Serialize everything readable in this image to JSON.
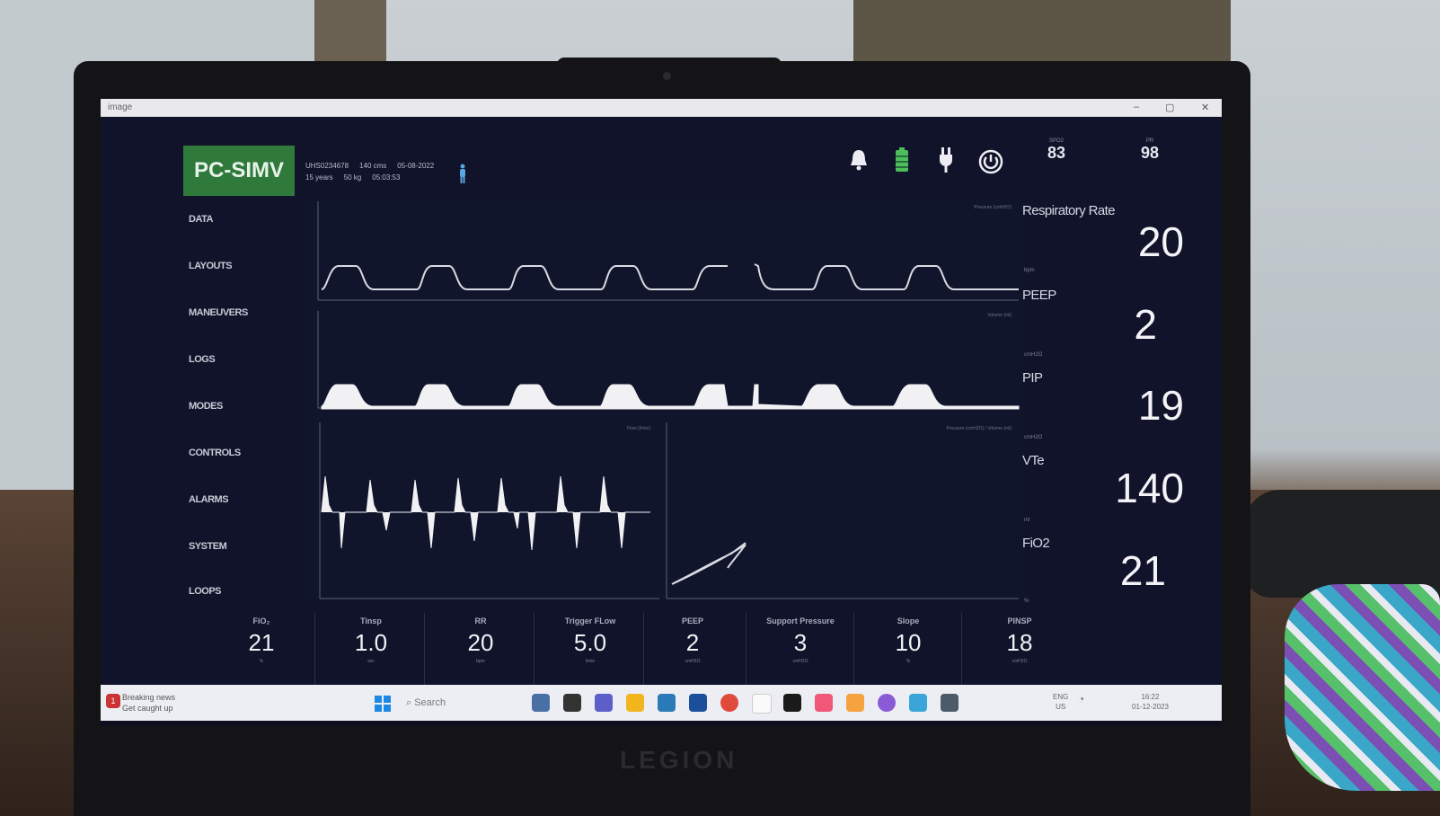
{
  "window": {
    "title": "image",
    "controls": [
      "–",
      "▢",
      "✕"
    ]
  },
  "mode": "PC-SIMV",
  "patient": {
    "id": "UHS0234678",
    "height": "140 cms",
    "date": "05-08-2022",
    "age": "15 years",
    "weight": "50 kg",
    "time": "05:03:53"
  },
  "status_icons": [
    "bell-icon",
    "battery-icon",
    "power-plug-icon",
    "power-button-icon"
  ],
  "top_vitals": [
    {
      "label": "SPO2",
      "value": "83"
    },
    {
      "label": "PR",
      "value": "98"
    }
  ],
  "nav": [
    "DATA",
    "LAYOUTS",
    "MANEUVERS",
    "LOGS",
    "MODES",
    "CONTROLS",
    "ALARMS",
    "SYSTEM",
    "LOOPS"
  ],
  "plots": {
    "pressure_title": "Pressure (cmH2O)",
    "volume_title": "Volume (ml)",
    "flow_title": "Flow (l/min)",
    "loop_title": "Pressure (cmH2O) / Volume (ml)"
  },
  "right_panel": [
    {
      "label": "Respiratory Rate",
      "unit": "bpm",
      "value": "20"
    },
    {
      "label": "PEEP",
      "unit": "cmH2O",
      "value": "2"
    },
    {
      "label": "PIP",
      "unit": "cmH2O",
      "value": "19"
    },
    {
      "label": "VTe",
      "unit": "ml",
      "value": "140"
    },
    {
      "label": "FiO2",
      "unit": "%",
      "value": "21"
    }
  ],
  "settings": [
    {
      "label": "FiO₂",
      "value": "21",
      "unit": "%"
    },
    {
      "label": "Tinsp",
      "value": "1.0",
      "unit": "sec"
    },
    {
      "label": "RR",
      "value": "20",
      "unit": "bpm"
    },
    {
      "label": "Trigger FLow",
      "value": "5.0",
      "unit": "l/min"
    },
    {
      "label": "PEEP",
      "value": "2",
      "unit": "cmH2O"
    },
    {
      "label": "Support Pressure",
      "value": "3",
      "unit": "cmH2O"
    },
    {
      "label": "Slope",
      "value": "10",
      "unit": "%"
    },
    {
      "label": "PINSP",
      "value": "18",
      "unit": "cmH2O"
    }
  ],
  "taskbar": {
    "news_title": "Breaking news",
    "news_sub": "Get caught up",
    "news_badge": "1",
    "search": "Search",
    "lang": "ENG",
    "region": "US",
    "time": "16:22",
    "date": "01-12-2023"
  },
  "brand": "LEGION"
}
